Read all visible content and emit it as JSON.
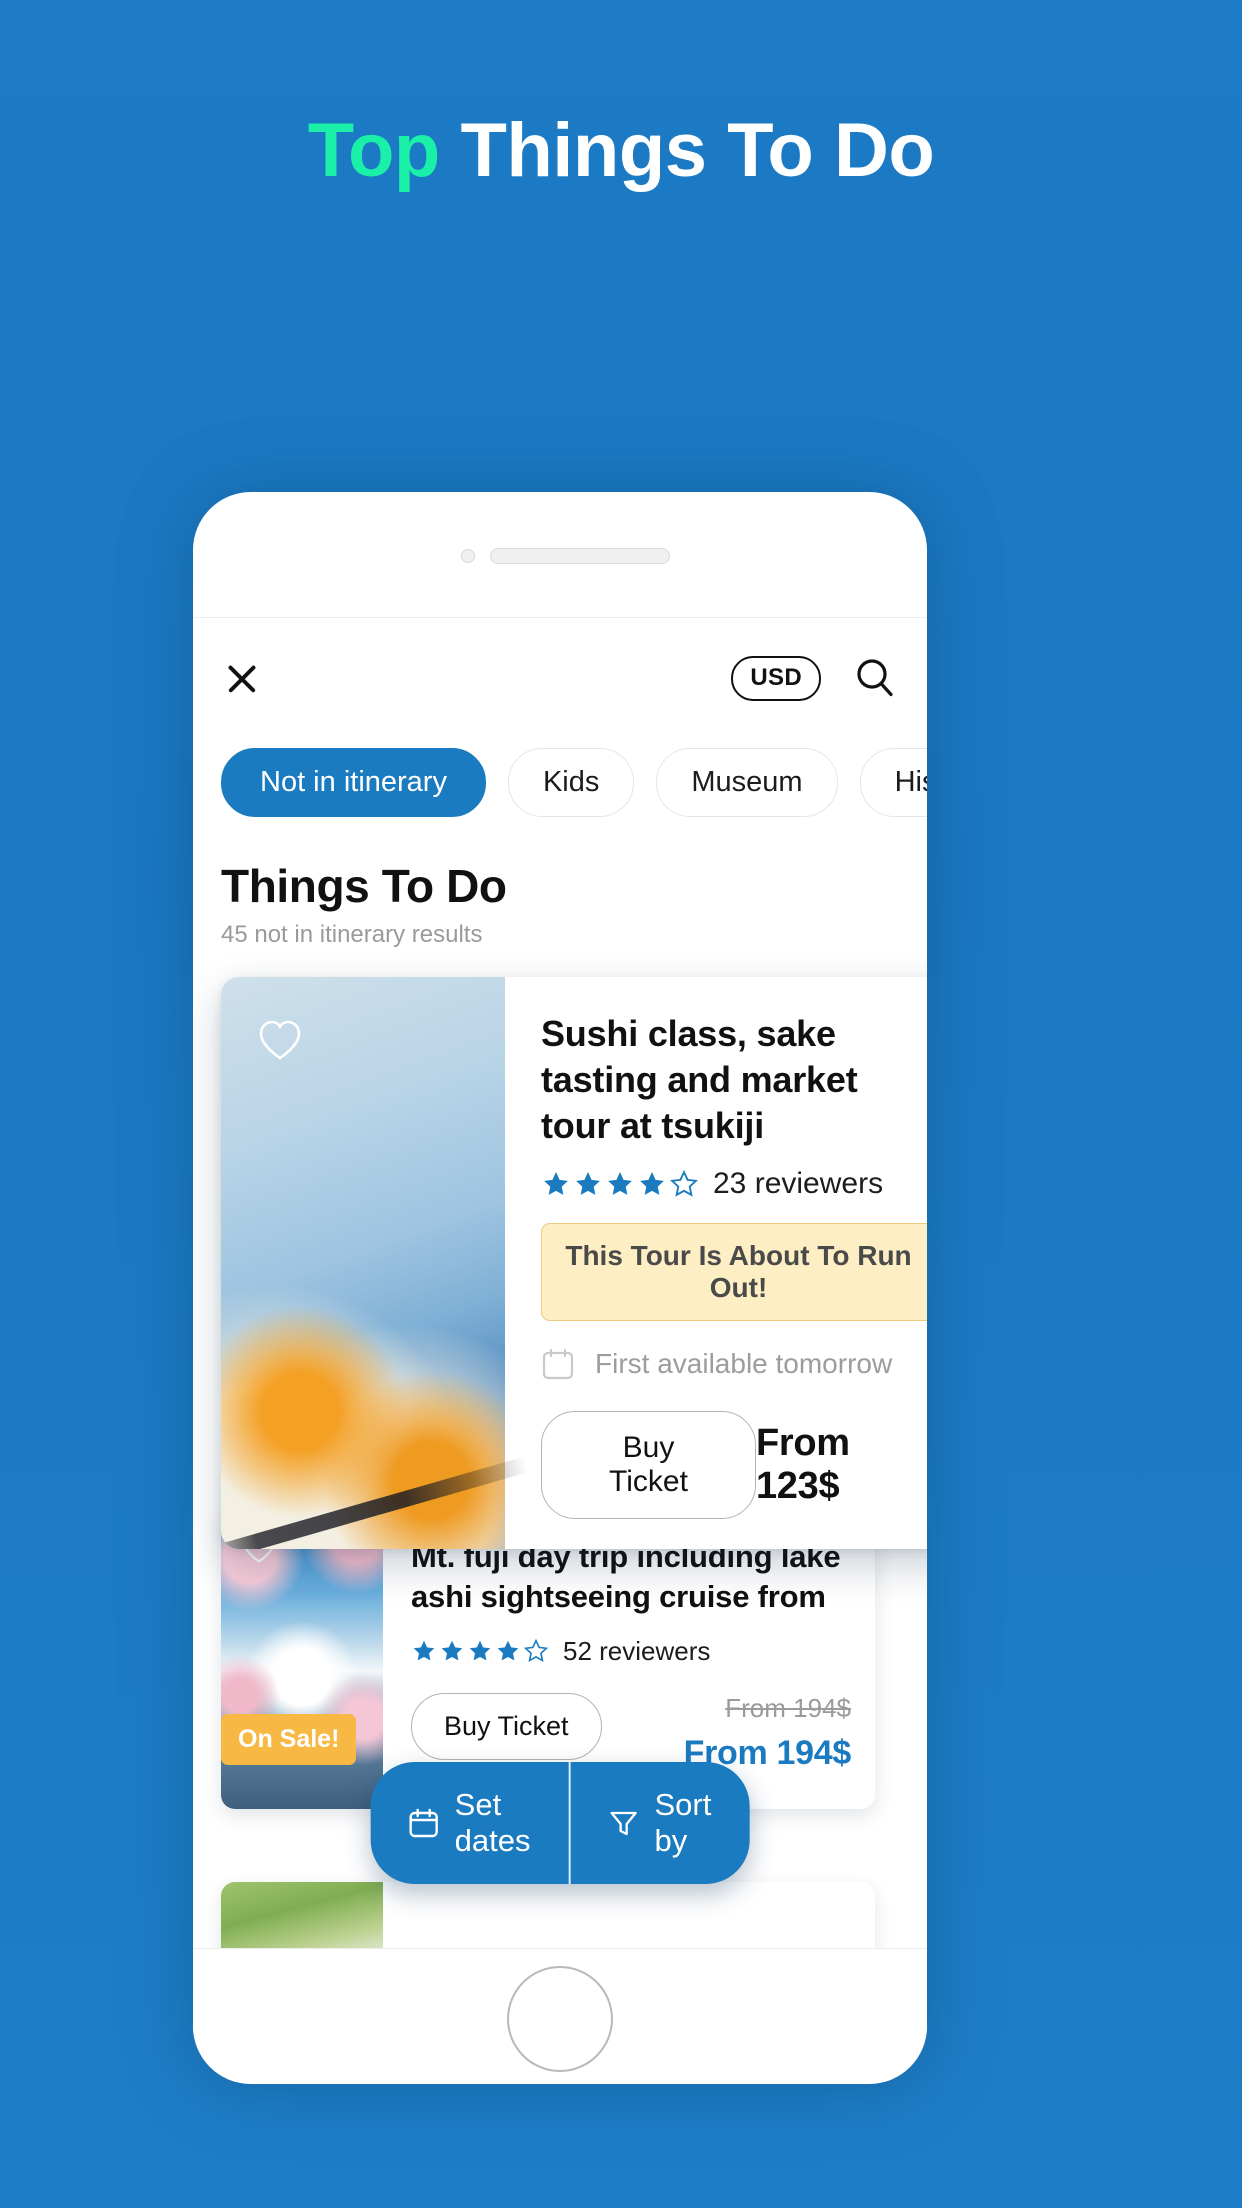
{
  "hero": {
    "title_accent": "Top",
    "title_rest": " Things To Do",
    "accent_color": "#1af0a8",
    "background_color": "#1b78c2"
  },
  "app_header": {
    "close_icon": "close-icon",
    "currency": "USD",
    "search_icon": "search-icon"
  },
  "filters": {
    "chips": [
      {
        "label": "Not in itinerary",
        "active": true
      },
      {
        "label": "Kids",
        "active": false
      },
      {
        "label": "Museum",
        "active": false
      },
      {
        "label": "Histo",
        "active": false
      }
    ]
  },
  "section": {
    "title": "Things To Do",
    "subtitle": "45 not in itinerary results"
  },
  "cards": [
    {
      "title": "Sushi class, sake tasting and market tour at tsukiji",
      "stars_filled": 4,
      "stars_total": 5,
      "reviews": "23 reviewers",
      "alert": "This Tour Is About To Run Out!",
      "availability": "First available tomorrow",
      "cta": "Buy Ticket",
      "price": "From 123$",
      "favorite_icon": "heart-outline-icon",
      "calendar_icon": "calendar-icon"
    },
    {
      "title": "Mt. fuji day trip including lake ashi sightseeing cruise from",
      "stars_filled": 4,
      "stars_total": 5,
      "reviews": "52 reviewers",
      "sale_badge": "On Sale!",
      "cta": "Buy Ticket",
      "price_old": "From 194$",
      "price_new": "From 194$",
      "favorite_icon": "heart-outline-icon"
    }
  ],
  "floating_bar": {
    "set_dates": "Set dates",
    "sort_by": "Sort by",
    "calendar_icon": "calendar-icon",
    "filter_icon": "filter-funnel-icon"
  },
  "colors": {
    "brand_blue": "#1a7bc0",
    "accent_green": "#1af0a8",
    "alert_amber_bg": "#fdeec4",
    "alert_amber_border": "#eec97a",
    "sale_amber": "#f7b944",
    "star_blue": "#1a7bc0"
  }
}
